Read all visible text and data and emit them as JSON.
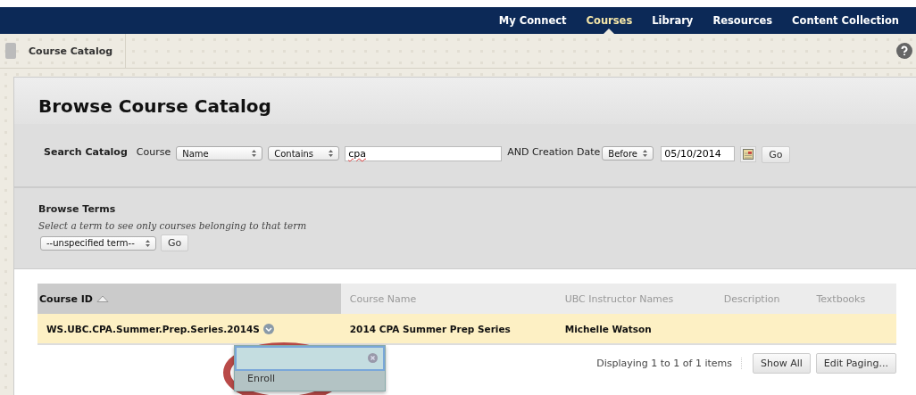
{
  "nav": [
    {
      "label": "My Connect",
      "selected": false
    },
    {
      "label": "Courses",
      "selected": true
    },
    {
      "label": "Library",
      "selected": false
    },
    {
      "label": "Resources",
      "selected": false
    },
    {
      "label": "Content Collection",
      "selected": false
    }
  ],
  "breadcrumb": "Course Catalog",
  "page_title": "Browse Course Catalog",
  "search": {
    "label": "Search Catalog",
    "course_label": "Course",
    "field": "Name",
    "operator": "Contains",
    "query": "cpa",
    "date_label": "AND Creation Date",
    "date_operator": "Before",
    "date": "05/10/2014",
    "go": "Go"
  },
  "browse_terms": {
    "title": "Browse Terms",
    "hint": "Select a term to see only courses belonging to that term",
    "term": "--unspecified term--",
    "go": "Go"
  },
  "table": {
    "columns": [
      {
        "label": "Course ID",
        "sorted": true
      },
      {
        "label": "Course Name",
        "sorted": false
      },
      {
        "label": "UBC Instructor Names",
        "sorted": false
      },
      {
        "label": "Description",
        "sorted": false
      },
      {
        "label": "Textbooks",
        "sorted": false
      }
    ],
    "rows": [
      {
        "highlighted": true,
        "cells": [
          "WS.UBC.CPA.Summer.Prep.Series.2014S",
          "2014 CPA Summer Prep Series",
          "Michelle Watson",
          "",
          ""
        ]
      }
    ]
  },
  "paging": {
    "text": "Displaying 1 to 1 of 1 items",
    "buttons": [
      "Show All",
      "Edit Paging..."
    ]
  },
  "context_menu": {
    "items": [
      "Enroll"
    ]
  }
}
